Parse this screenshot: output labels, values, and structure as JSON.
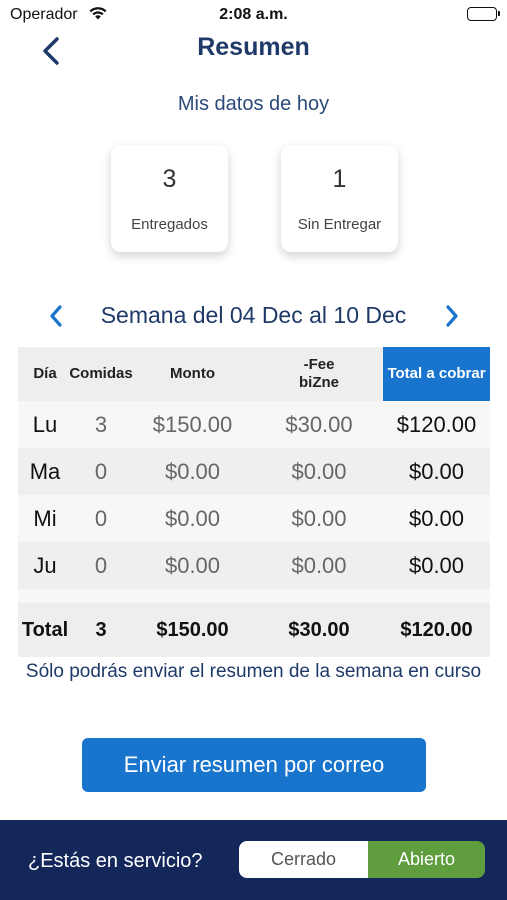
{
  "status_bar": {
    "carrier": "Operador",
    "time": "2:08 a.m."
  },
  "nav": {
    "title": "Resumen"
  },
  "today": {
    "subtitle": "Mis datos de hoy",
    "delivered": {
      "value": "3",
      "label": "Entregados"
    },
    "undelivered": {
      "value": "1",
      "label": "Sin Entregar"
    }
  },
  "week": {
    "label": "Semana del 04 Dec al 10 Dec"
  },
  "table": {
    "headers": {
      "day": "Día",
      "meals": "Comidas",
      "amount": "Monto",
      "fee_line1": "-Fee",
      "fee_line2": "biZne",
      "total": "Total a cobrar"
    },
    "rows": [
      {
        "day": "Lu",
        "meals": "3",
        "amount": "$150.00",
        "fee": "$30.00",
        "total": "$120.00"
      },
      {
        "day": "Ma",
        "meals": "0",
        "amount": "$0.00",
        "fee": "$0.00",
        "total": "$0.00"
      },
      {
        "day": "Mi",
        "meals": "0",
        "amount": "$0.00",
        "fee": "$0.00",
        "total": "$0.00"
      },
      {
        "day": "Ju",
        "meals": "0",
        "amount": "$0.00",
        "fee": "$0.00",
        "total": "$0.00"
      }
    ],
    "totals": {
      "label": "Total",
      "meals": "3",
      "amount": "$150.00",
      "fee": "$30.00",
      "total": "$120.00"
    }
  },
  "notice": "Sólo podrás enviar el resumen de la semana en curso",
  "send_button": "Enviar resumen por correo",
  "footer": {
    "question": "¿Estás en servicio?",
    "closed": "Cerrado",
    "open": "Abierto",
    "selected": "Abierto"
  },
  "colors": {
    "accent": "#1874cd",
    "navy": "#14275a",
    "title": "#1f3a68",
    "active_toggle": "#5f9d3e"
  }
}
